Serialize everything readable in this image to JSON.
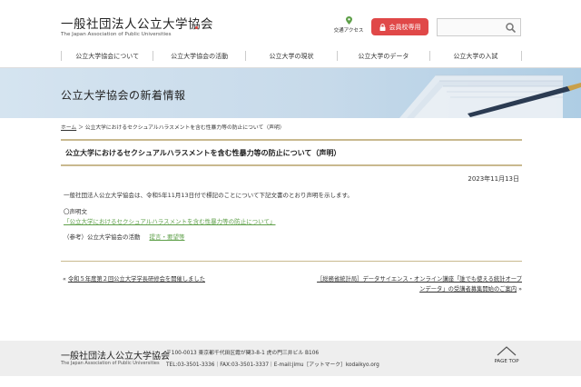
{
  "header": {
    "logo_jp": "一般社団法人公立大学協会",
    "logo_en": "The Japan Association of Public Universities",
    "access_label": "交通アクセス",
    "member_label": "会員校専用",
    "search_placeholder": "",
    "accent_color": "#e04848"
  },
  "nav": {
    "items": [
      {
        "label": "公立大学協会について"
      },
      {
        "label": "公立大学協会の活動"
      },
      {
        "label": "公立大学の現状"
      },
      {
        "label": "公立大学のデータ"
      },
      {
        "label": "公立大学の入試"
      }
    ]
  },
  "banner": {
    "title": "公立大学協会の新着情報"
  },
  "breadcrumb": {
    "home": "ホーム",
    "separator": "＞",
    "current": "公立大学におけるセクシュアルハラスメントを含む性暴力等の防止について（声明）"
  },
  "article": {
    "title": "公立大学におけるセクシュアルハラスメントを含む性暴力等の防止について（声明）",
    "date": "2023年11月13日",
    "intro": "一般社団法人公立大学協会は、令和5年11月13日付で標記のことについて下記文書のとおり声明を示します。",
    "statement_heading": "〇声明文",
    "statement_link": "「公立大学におけるセクシュアルハラスメントを含む性暴力等の防止について」",
    "ref_label": "（参考）公立大学協会の活動",
    "ref_link": "提言・要望等"
  },
  "pager": {
    "prev_arrow": "«",
    "prev": "令和５年度第２回公立大学学長研修会を開催しました",
    "next_line1": "［総務省統計局］データサイエンス・オンライン講座「誰でも使える統計オープ",
    "next_line2": "ンデータ」の受講者募集開始のご案内",
    "next_arrow": "»"
  },
  "footer": {
    "org_jp": "一般社団法人公立大学協会",
    "org_en": "The Japan Association of Public Universities",
    "address": "〒100-0013 東京都千代田区霞が関3-8-1 虎の門三井ビル B106",
    "contact": "TEL:03-3501-3336｜FAX:03-3501-3337｜E-mail:jimu［アットマーク］kodaikyo.org",
    "page_top": "PAGE TOP"
  }
}
